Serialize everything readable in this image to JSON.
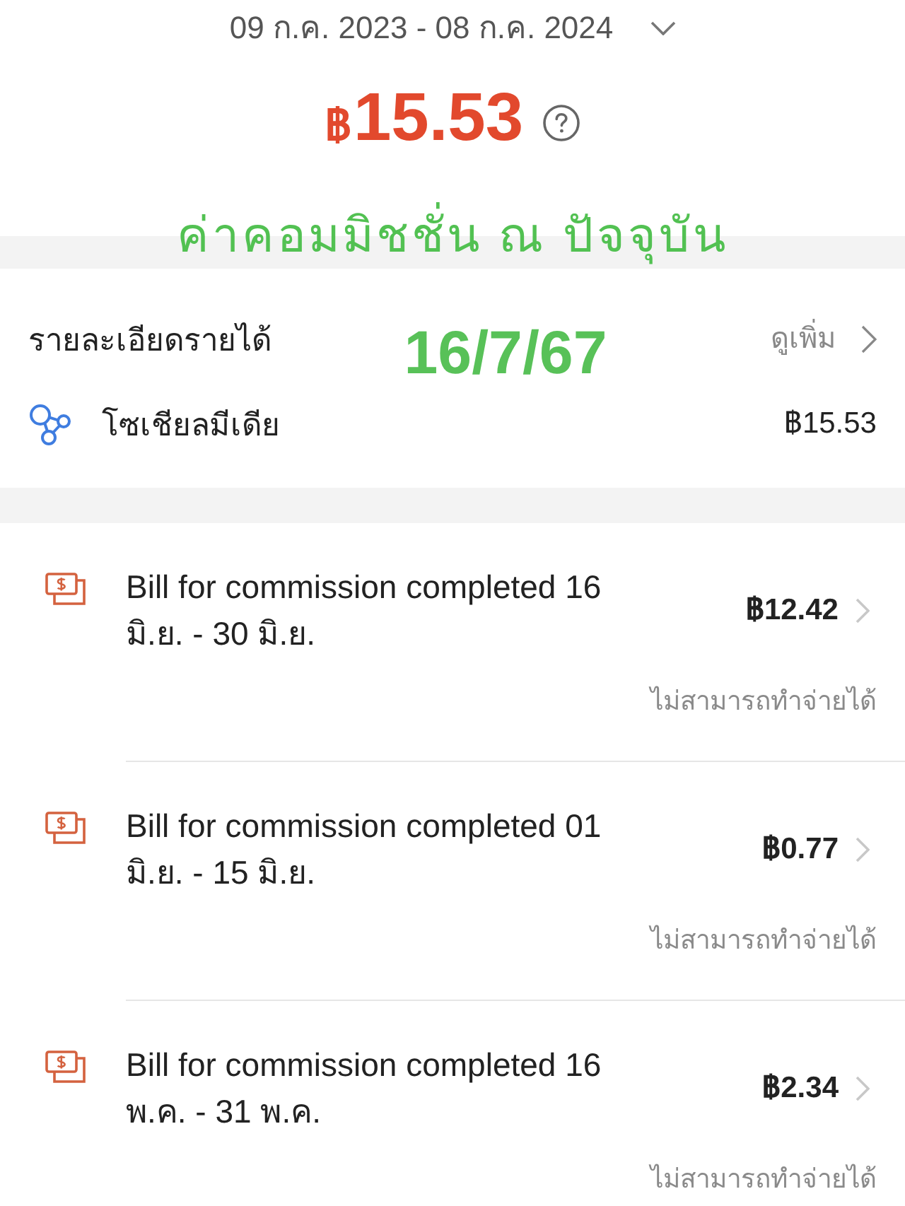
{
  "header": {
    "date_range": "09 ก.ค. 2023 - 08 ก.ค. 2024",
    "currency_symbol": "฿",
    "total": "15.53",
    "note": "ค่าคอมมิชชั่น ณ ปัจจุบัน"
  },
  "income_details": {
    "title": "รายละเอียดรายได้",
    "note": "16/7/67",
    "more_link": "ดูเพิ่ม",
    "sources": [
      {
        "name": "โซเชียลมีเดีย",
        "amount": "฿15.53"
      }
    ]
  },
  "bills": [
    {
      "title": "Bill for commission completed 16 มิ.ย. - 30 มิ.ย.",
      "amount": "฿12.42",
      "status": "ไม่สามารถทำจ่ายได้"
    },
    {
      "title": "Bill for commission completed 01 มิ.ย. - 15 มิ.ย.",
      "amount": "฿0.77",
      "status": "ไม่สามารถทำจ่ายได้"
    },
    {
      "title": "Bill for commission completed 16 พ.ค. - 31 พ.ค.",
      "amount": "฿2.34",
      "status": "ไม่สามารถทำจ่ายได้"
    }
  ]
}
